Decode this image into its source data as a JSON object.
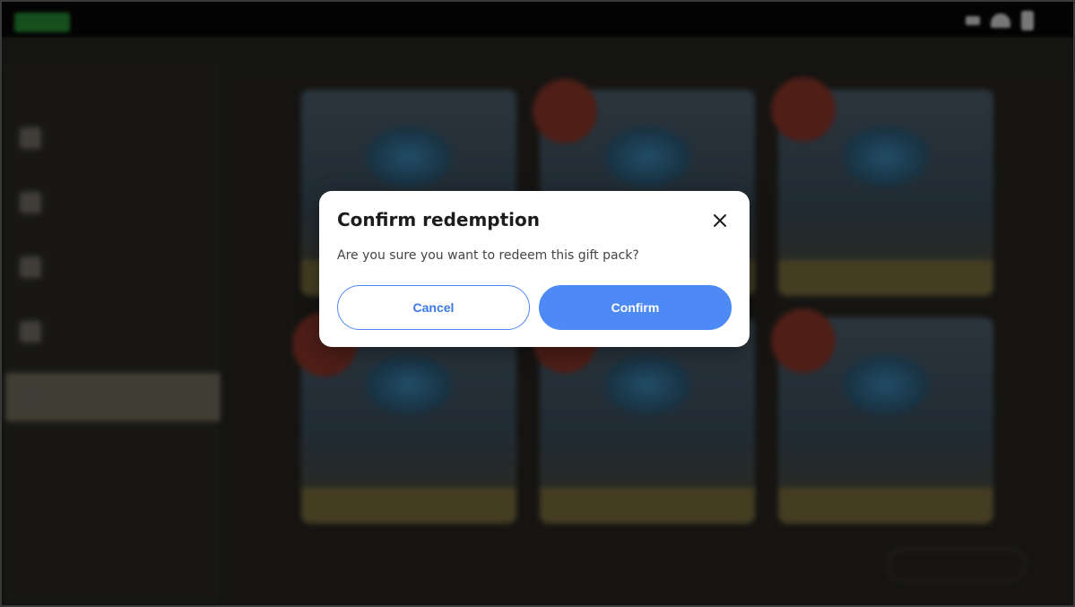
{
  "dialog": {
    "title": "Confirm redemption",
    "message": "Are you sure you want to redeem this gift pack?",
    "cancel_label": "Cancel",
    "confirm_label": "Confirm",
    "close_icon": "close-icon"
  },
  "background": {
    "sidebar_items": [
      {
        "icon": "recommended-icon"
      },
      {
        "icon": "character-icon"
      },
      {
        "icon": "shop-icon"
      },
      {
        "icon": "reward-icon"
      },
      {
        "icon": "crystal-icon",
        "active": true
      }
    ],
    "products": [
      {
        "icon": "crystal-bundle-icon"
      },
      {
        "icon": "crystal-bundle-icon"
      },
      {
        "icon": "crystal-bundle-icon"
      },
      {
        "icon": "crystal-bundle-icon"
      },
      {
        "icon": "crystal-bundle-icon"
      },
      {
        "icon": "crystal-bundle-icon"
      }
    ]
  },
  "colors": {
    "accent": "#4d8af5",
    "overlay": "#1b1a17",
    "dialog_bg": "#ffffff"
  }
}
